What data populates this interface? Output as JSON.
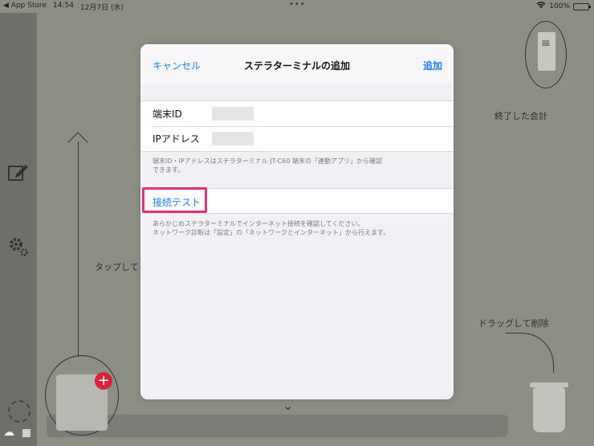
{
  "status_bar": {
    "back_app": "◀ App Store",
    "time": "14:54",
    "date": "12月7日 (水)",
    "dots": "•••",
    "battery": "100%"
  },
  "background": {
    "finished_label": "終了した会計",
    "tap_label": "タップして",
    "drag_delete_label": "ドラッグして削除"
  },
  "modal": {
    "cancel": "キャンセル",
    "title": "ステラターミナルの追加",
    "add": "追加",
    "terminal_id_label": "端末ID",
    "ip_label": "IPアドレス",
    "note1_line1": "端末ID・IPアドレスはステラターミナル JT-C60 端末の「連動アプリ」から確認",
    "note1_line2": "できます。",
    "connection_test": "接続テスト",
    "note2_line1": "あらかじめステラターミナルでインターネット接続を確認してください。",
    "note2_line2": "ネットワーク診断は「設定」の「ネットワークとインターネット」から行えます。"
  },
  "colors": {
    "accent": "#1e7cf2",
    "highlight": "#e0307f",
    "badge": "#d8243a"
  }
}
